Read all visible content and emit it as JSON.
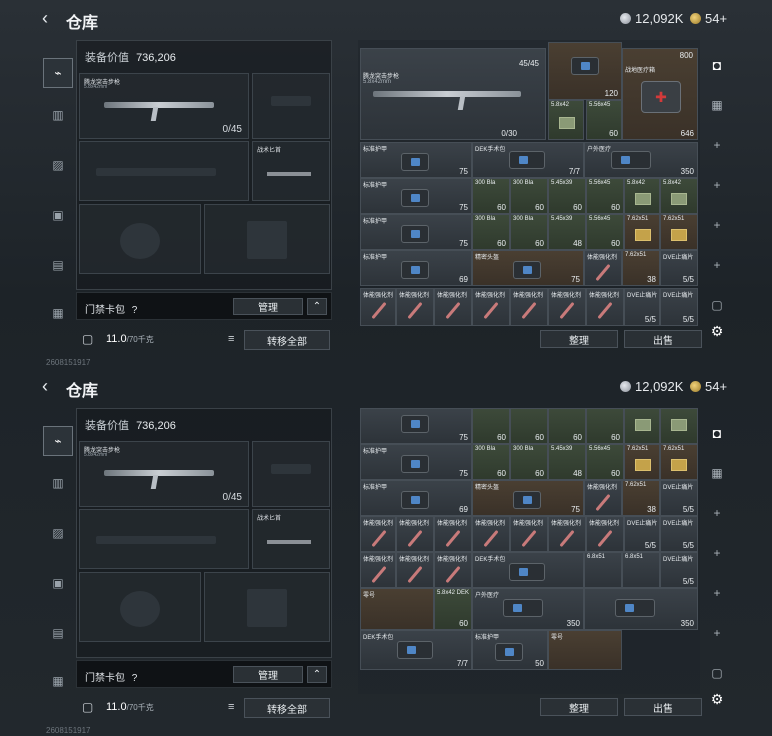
{
  "header": {
    "title": "仓库",
    "silver": "12,092K",
    "gold": "54+"
  },
  "equipment": {
    "value_label": "装备价值",
    "value": "736,206",
    "primary_weapon": {
      "name": "腾龙突击步枪",
      "caliber": "5.8x42mm",
      "ammo": "0/45"
    },
    "melee": {
      "name": "战术匕首"
    },
    "keycard_label": "门禁卡包",
    "keycard_help": "?",
    "manage": "管理",
    "weight": "11.0",
    "weight_max": "/70千克",
    "transfer_all": "转移全部"
  },
  "top_grid": {
    "weapon": {
      "name": "腾龙突击步枪",
      "caliber": "5.8x42mm",
      "count": "45/45",
      "ammo": "0/30"
    },
    "med_count": "800",
    "med_name": "战地医疗箱",
    "med_bottom": "646",
    "scan_count": "120",
    "ammo1": "5.8x42",
    "ammo2": "5.56x45",
    "ammo_val": "60",
    "armor": "标准护甲",
    "dek": "DEK手术包",
    "dek_count": "7/7",
    "outdoor": "户外医疗",
    "outdoor_val": "350",
    "helmet": "精密头盔",
    "stim": "体能强化剂",
    "r2c1_val": "75",
    "row3": {
      "a": "300 Bla",
      "b": "300 Bla",
      "c": "5.45x39",
      "d": "5.56x45",
      "e": "7.62x51",
      "f": "7.62x51"
    },
    "vals": {
      "v60": "60",
      "v48": "48",
      "v69": "69",
      "v75": "75",
      "v38": "38",
      "v55": "5/5"
    },
    "dve": "DVE止痛片"
  },
  "bottom_grid": {
    "sniper_ammo": "6.8x51",
    "misc": "零号",
    "ammo58": "5.8x42 DEK",
    "v50": "50",
    "v350": "350"
  },
  "actions": {
    "sort": "整理",
    "sell": "出售"
  },
  "uid": "2608151917"
}
